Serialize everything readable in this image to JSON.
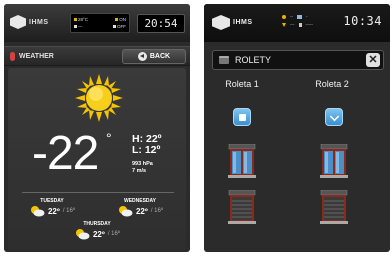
{
  "left_screen": {
    "logo_text": "IHMS",
    "mini_status": {
      "temp": "28°C",
      "state1": "ON",
      "state2": "OFF"
    },
    "clock": "20:54",
    "menu": {
      "title": "WEATHER",
      "back_label": "BACK"
    },
    "current": {
      "temperature": "-22",
      "degree": "°",
      "high": "H: 22º",
      "low": "L: 12º",
      "pressure": "993 hPa",
      "wind": "7 m/s"
    },
    "forecast": [
      {
        "day": "TUESDAY",
        "high": "22º",
        "low": "/ 16º"
      },
      {
        "day": "WEDNESDAY",
        "high": "22º",
        "low": "/ 16º"
      },
      {
        "day": "THURSDAY",
        "high": "22º",
        "low": "/ 16º"
      }
    ],
    "colors": {
      "sun": "#f5c400",
      "background": "#2b2b2b"
    }
  },
  "right_screen": {
    "logo_text": "IHMS",
    "clock": "10:34",
    "header_title": "ROLETY",
    "close_label": "✕",
    "columns": [
      {
        "label": "Roleta 1",
        "button": "stop-icon"
      },
      {
        "label": "Roleta 2",
        "button": "chevron-down-icon"
      }
    ],
    "colors": {
      "accent": "#4aa3e0"
    }
  }
}
